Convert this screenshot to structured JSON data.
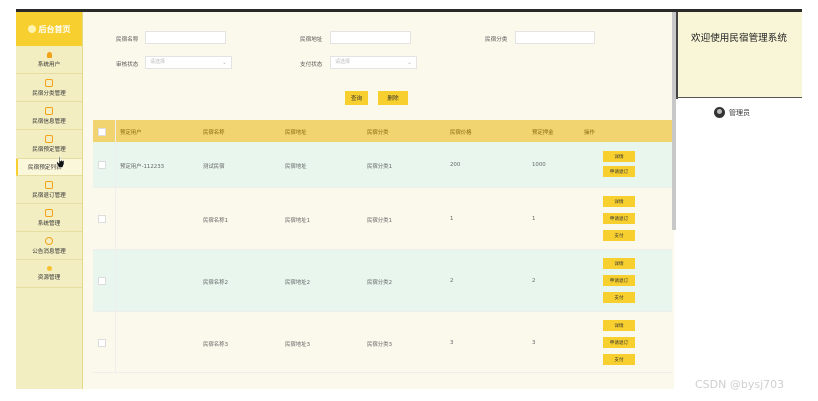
{
  "sidebar": {
    "brand": "后台首页",
    "items": [
      {
        "label": "系统用户",
        "icon": "person-icon"
      },
      {
        "label": "民宿分类管理",
        "icon": "square-icon"
      },
      {
        "label": "民宿信息管理",
        "icon": "square-icon"
      },
      {
        "label": "民宿预定管理",
        "icon": "square-icon"
      }
    ],
    "sub_item": "民宿预定列表",
    "items2": [
      {
        "label": "民宿退订管理",
        "icon": "square-icon"
      },
      {
        "label": "系统管理",
        "icon": "square-icon"
      },
      {
        "label": "公告消息管理",
        "icon": "circle-icon"
      },
      {
        "label": "资源管理",
        "icon": "bulb-icon"
      }
    ]
  },
  "search": {
    "name_label": "民宿名称",
    "name_value": "",
    "address_label": "民宿地址",
    "address_value": "",
    "category_label": "民宿分类",
    "category_value": "",
    "review_label": "审核状态",
    "review_placeholder": "请选择",
    "pay_label": "支付状态",
    "pay_placeholder": "请选择",
    "query_button": "查询",
    "delete_button": "删除"
  },
  "table": {
    "headers": [
      "预定用户",
      "民宿名称",
      "民宿地址",
      "民宿分类",
      "民宿价格",
      "预定押金",
      "操作"
    ],
    "rows": [
      {
        "cells": [
          "预定用户-112233",
          "测试民宿",
          "民宿地址",
          "民宿分类1",
          "200",
          "1000"
        ],
        "actions": [
          "详情",
          "申请退订"
        ]
      },
      {
        "cells": [
          "",
          "民宿名称1",
          "民宿地址1",
          "民宿分类1",
          "1",
          "1"
        ],
        "actions": [
          "详情",
          "申请退订",
          "支付"
        ]
      },
      {
        "cells": [
          "",
          "民宿名称2",
          "民宿地址2",
          "民宿分类2",
          "2",
          "2"
        ],
        "actions": [
          "详情",
          "申请退订",
          "支付"
        ]
      },
      {
        "cells": [
          "",
          "民宿名称3",
          "民宿地址3",
          "民宿分类3",
          "3",
          "3"
        ],
        "actions": [
          "详情",
          "申请退订",
          "支付"
        ]
      }
    ]
  },
  "header": {
    "welcome": "欢迎使用民宿管理系统",
    "user": "管理员"
  },
  "watermark": "CSDN @bysj703",
  "colors": {
    "accent": "#f7cf2e",
    "header_row": "#f1d36f",
    "row_highlight": "#e8f6ee",
    "sidebar_bg": "#f3eec2"
  }
}
